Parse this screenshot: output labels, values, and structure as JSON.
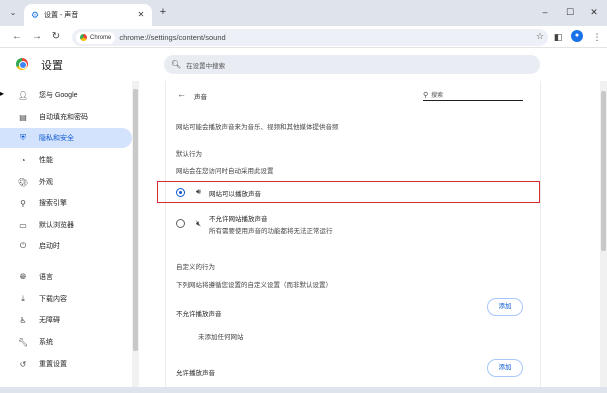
{
  "tab": {
    "title": "设置 - 声音",
    "icon": "gear-icon"
  },
  "window_controls": {
    "minimize": "–",
    "maximize": "☐",
    "close": "✕"
  },
  "toolbar": {
    "chip_label": "Chrome",
    "url": "chrome://settings/content/sound"
  },
  "settings": {
    "title": "设置",
    "search_placeholder": "在设置中搜索"
  },
  "sidebar": {
    "items": [
      {
        "label": "您与 Google",
        "icon": "person-icon"
      },
      {
        "label": "自动填充和密码",
        "icon": "clipboard-icon"
      },
      {
        "label": "隐私和安全",
        "icon": "shield-icon",
        "active": true
      },
      {
        "label": "性能",
        "icon": "speedometer-icon"
      },
      {
        "label": "外观",
        "icon": "palette-icon"
      },
      {
        "label": "搜索引擎",
        "icon": "search-icon"
      },
      {
        "label": "默认浏览器",
        "icon": "browser-icon"
      },
      {
        "label": "启动时",
        "icon": "power-icon"
      },
      {
        "label": "语言",
        "icon": "globe-icon"
      },
      {
        "label": "下载内容",
        "icon": "download-icon"
      },
      {
        "label": "无障碍",
        "icon": "accessibility-icon"
      },
      {
        "label": "系统",
        "icon": "wrench-icon"
      },
      {
        "label": "重置设置",
        "icon": "reset-icon"
      }
    ]
  },
  "sound_page": {
    "title": "声音",
    "search_text": "搜索",
    "description": "网站可能会播放声音来为音乐、视频和其他媒体提供音频",
    "default_heading": "默认行为",
    "default_sub": "网站会在您访问时自动采用此设置",
    "option_allow": "网站可以播放声音",
    "option_block": "不允许网站播放声音",
    "option_block_sub": "所有需要使用声音的功能都将无法正常运行",
    "custom_heading": "自定义的行为",
    "custom_sub": "下列网站将遵循您设置的自定义设置（而非默认设置）",
    "block_list_label": "不允许播放声音",
    "block_list_empty": "未添加任何网站",
    "allow_list_label": "允许播放声音",
    "add_button": "添加"
  }
}
